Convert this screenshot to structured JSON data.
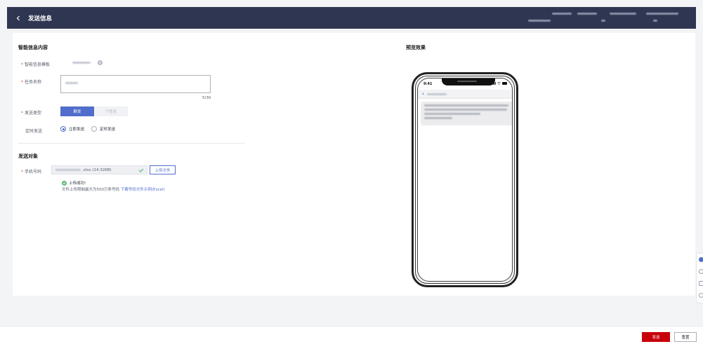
{
  "header": {
    "title": "发送信息",
    "back_icon": "chevron-left-icon"
  },
  "form": {
    "section_content_title": "智能信息内容",
    "template_label": "智能信息模板",
    "task_name_label": "任务名称",
    "task_name_counter": "5/30",
    "send_type_label": "发送类型",
    "send_type_options": [
      "群发",
      "个性化"
    ],
    "send_type_selected": "群发",
    "schedule_label": "定时发送",
    "schedule_options": [
      "立即发送",
      "定时发送"
    ],
    "schedule_selected": "立即发送",
    "section_target_title": "发送对象",
    "phone_label": "手机号码",
    "file_name_suffix": ".xlsx (14.32KB)",
    "upload_button": "上传文件",
    "upload_success": "上传成功!",
    "upload_hint": "文件上传限制最大为500万条号码",
    "download_link": "下载号码文件示例(Excel)"
  },
  "preview": {
    "title": "预览效果",
    "phone_time": "9:41"
  },
  "footer": {
    "send_button": "发送",
    "reset_button": "重置"
  },
  "colors": {
    "topbar": "#2f3652",
    "accent": "#526ecc",
    "primary_button": "#c7000b",
    "required": "#e5534b",
    "success": "#5fb878"
  }
}
